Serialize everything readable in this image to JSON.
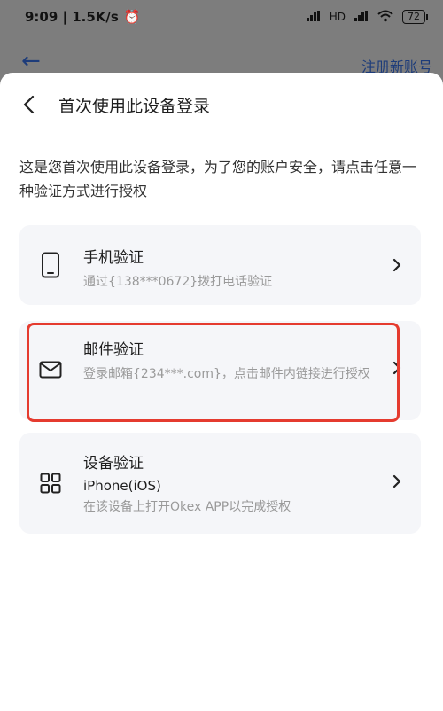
{
  "status_bar": {
    "time": "9:09 | 1.5K/s",
    "network": "HD",
    "battery": "72"
  },
  "background_nav": {
    "register": "注册新账号"
  },
  "sheet": {
    "title": "首次使用此设备登录",
    "description": "这是您首次使用此设备登录，为了您的账户安全，请点击任意一种验证方式进行授权"
  },
  "options": [
    {
      "title": "手机验证",
      "subtitle": "通过{138***0672}拨打电话验证",
      "icon": "phone-icon"
    },
    {
      "title": "邮件验证",
      "subtitle": "登录邮箱{234***.com}，点击邮件内链接进行授权",
      "icon": "mail-icon"
    },
    {
      "title": "设备验证",
      "device": "iPhone(iOS)",
      "subtitle": "在该设备上打开Okex APP以完成授权",
      "icon": "grid-icon"
    }
  ],
  "colors": {
    "highlight": "#e53b2f",
    "link": "#1d3c7a",
    "card": "#f5f6f9"
  }
}
